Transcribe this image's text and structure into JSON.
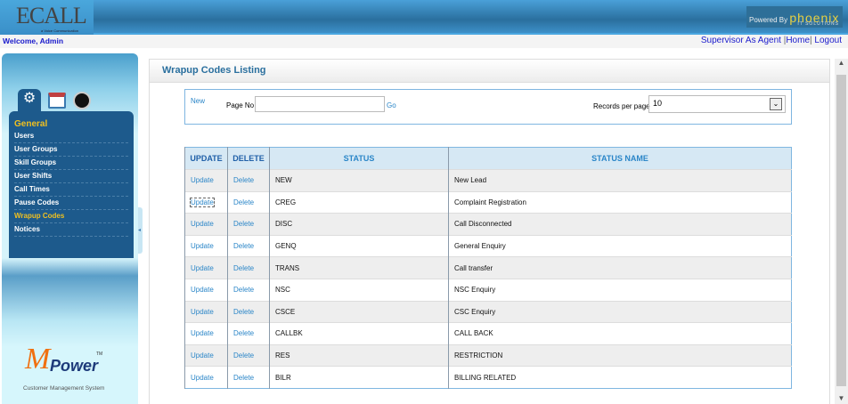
{
  "header": {
    "logo_text": "ECALL",
    "logo_tagline": "a Voice Communication",
    "powered_by": "Powered By",
    "brand": "phoenix",
    "brand_sub": "IT SOLUTIONS"
  },
  "welcome": "Welcome,  Admin",
  "top_links": {
    "supervisor": "Supervisor As Agent",
    "sep1": " |",
    "home": "Home",
    "sep2": "| ",
    "logout": "Logout"
  },
  "sidebar": {
    "section": "General",
    "items": [
      {
        "label": "Users"
      },
      {
        "label": "User Groups"
      },
      {
        "label": "Skill Groups"
      },
      {
        "label": "User Shifts"
      },
      {
        "label": "Call Times"
      },
      {
        "label": "Pause Codes"
      },
      {
        "label": "Wrapup Codes",
        "active": true
      },
      {
        "label": "Notices"
      }
    ],
    "tab_icons": [
      "settings-icon",
      "calendar-icon",
      "dashboard-gauge-icon"
    ],
    "footer_logo": "Power",
    "footer_tm": "TM",
    "footer_tagline": "Customer Management System"
  },
  "page": {
    "title": "Wrapup Codes Listing",
    "new_link": "New",
    "page_no_label": "Page No",
    "page_no_value": "",
    "go_label": "Go",
    "records_label": "Records per page",
    "records_value": "10"
  },
  "table": {
    "headers": [
      "UPDATE",
      "DELETE",
      "STATUS",
      "STATUS NAME"
    ],
    "rows": [
      {
        "update": "Update",
        "delete": "Delete",
        "status": "NEW",
        "name": "New Lead"
      },
      {
        "update": "Update",
        "delete": "Delete",
        "status": "CREG",
        "name": "Complaint Registration"
      },
      {
        "update": "Update",
        "delete": "Delete",
        "status": "DISC",
        "name": "Call Disconnected"
      },
      {
        "update": "Update",
        "delete": "Delete",
        "status": "GENQ",
        "name": "General Enquiry"
      },
      {
        "update": "Update",
        "delete": "Delete",
        "status": "TRANS",
        "name": "Call transfer"
      },
      {
        "update": "Update",
        "delete": "Delete",
        "status": "NSC",
        "name": "NSC Enquiry"
      },
      {
        "update": "Update",
        "delete": "Delete",
        "status": "CSCE",
        "name": "CSC Enquiry"
      },
      {
        "update": "Update",
        "delete": "Delete",
        "status": "CALLBK",
        "name": "CALL BACK"
      },
      {
        "update": "Update",
        "delete": "Delete",
        "status": "RES",
        "name": "RESTRICTION"
      },
      {
        "update": "Update",
        "delete": "Delete",
        "status": "BILR",
        "name": "BILLING RELATED"
      }
    ]
  },
  "colors": {
    "header_blue": "#2a6f9e",
    "menu_bg": "#1d5a8c",
    "active": "#f0c020",
    "link": "#2b86c8"
  }
}
